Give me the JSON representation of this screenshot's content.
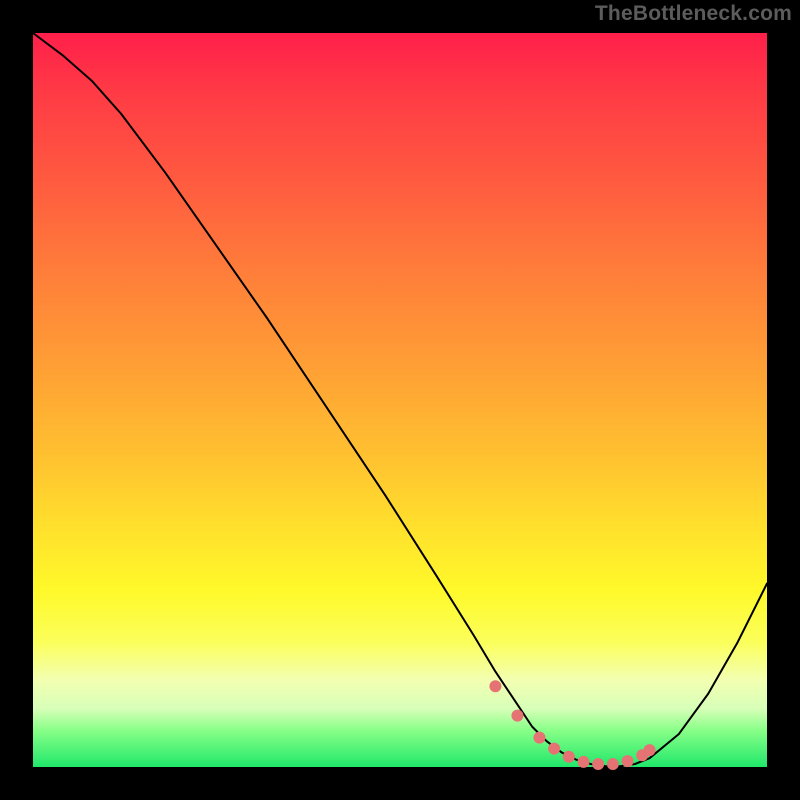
{
  "watermark": "TheBottleneck.com",
  "chart_data": {
    "type": "line",
    "title": "",
    "xlabel": "",
    "ylabel": "",
    "xlim": [
      0,
      100
    ],
    "ylim": [
      0,
      100
    ],
    "series": [
      {
        "name": "bottleneck-curve",
        "x": [
          0,
          4,
          8,
          12,
          18,
          25,
          32,
          40,
          48,
          55,
          60,
          63,
          66,
          68,
          70,
          72,
          74,
          76,
          78,
          80,
          82,
          84,
          88,
          92,
          96,
          100
        ],
        "y": [
          100,
          97,
          93.5,
          89,
          81,
          71,
          61,
          49,
          37,
          26,
          18,
          13,
          8.5,
          5.5,
          3.5,
          2,
          1,
          0.4,
          0.1,
          0.1,
          0.4,
          1.2,
          4.5,
          10,
          17,
          25
        ],
        "color": "#000000",
        "width": 2
      }
    ],
    "markers": {
      "name": "highlight-dots",
      "color": "#e57373",
      "radius": 6,
      "x": [
        63,
        66,
        69,
        71,
        73,
        75,
        77,
        79,
        81,
        83,
        84
      ],
      "y": [
        11,
        7,
        4,
        2.5,
        1.4,
        0.7,
        0.4,
        0.4,
        0.8,
        1.6,
        2.3
      ]
    }
  }
}
